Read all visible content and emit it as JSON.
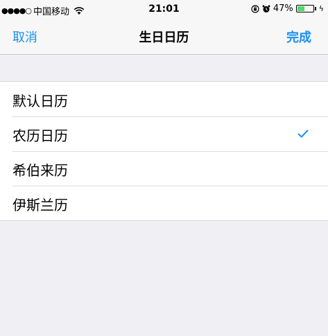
{
  "status_bar": {
    "signal": "●●●●○",
    "carrier": "中国移动",
    "time": "21:01",
    "battery_percent": "47%",
    "battery_level": 0.47
  },
  "nav": {
    "cancel_label": "取消",
    "title": "生日日历",
    "done_label": "完成"
  },
  "calendars": [
    {
      "label": "默认日历",
      "selected": false
    },
    {
      "label": "农历日历",
      "selected": true
    },
    {
      "label": "希伯来历",
      "selected": false
    },
    {
      "label": "伊斯兰历",
      "selected": false
    }
  ],
  "colors": {
    "accent": "#1a8ff0",
    "background": "#efeff4",
    "bar": "#f7f7f7",
    "battery_fill": "#4cd964"
  }
}
